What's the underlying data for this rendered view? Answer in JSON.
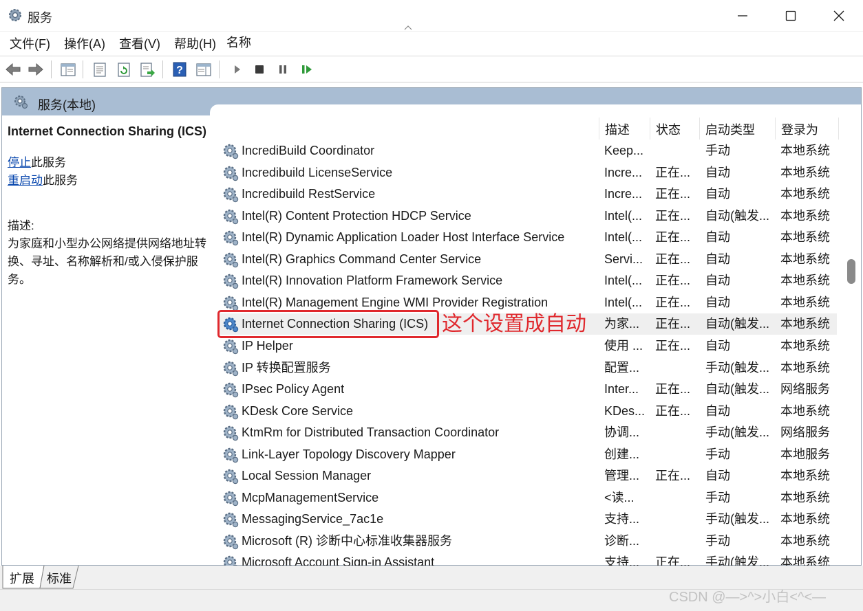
{
  "window": {
    "title": "服务",
    "icons": {
      "app": "gear-icon",
      "minimize": "minimize-icon",
      "maximize": "maximize-icon",
      "close": "close-icon"
    }
  },
  "menubar": {
    "items": [
      "文件(F)",
      "操作(A)",
      "查看(V)",
      "帮助(H)"
    ]
  },
  "toolbar": {
    "icons": [
      "back-arrow-icon",
      "forward-arrow-icon",
      "show-hide-console-tree-icon",
      "properties-icon",
      "refresh-icon",
      "export-list-icon",
      "help-icon",
      "show-action-pane-icon",
      "start-service-icon",
      "stop-service-icon",
      "pause-service-icon",
      "restart-service-icon"
    ]
  },
  "scope": {
    "title": "服务(本地)"
  },
  "detail": {
    "service_title": "Internet Connection Sharing (ICS)",
    "stop_link": "停止",
    "stop_suffix": "此服务",
    "restart_link": "重启动",
    "restart_suffix": "此服务",
    "desc_label": "描述:",
    "desc_text": "为家庭和小型办公网络提供网络地址转换、寻址、名称解析和/或入侵保护服务。"
  },
  "columns": {
    "name": "名称",
    "desc": "描述",
    "state": "状态",
    "startup": "启动类型",
    "logon": "登录为"
  },
  "services": [
    {
      "name": "IncrediBuild Coordinator",
      "desc": "Keep...",
      "state": "",
      "startup": "手动",
      "logon": "本地系统"
    },
    {
      "name": "Incredibuild LicenseService",
      "desc": "Incre...",
      "state": "正在...",
      "startup": "自动",
      "logon": "本地系统"
    },
    {
      "name": "Incredibuild RestService",
      "desc": "Incre...",
      "state": "正在...",
      "startup": "自动",
      "logon": "本地系统"
    },
    {
      "name": "Intel(R) Content Protection HDCP Service",
      "desc": "Intel(...",
      "state": "正在...",
      "startup": "自动(触发...",
      "logon": "本地系统"
    },
    {
      "name": "Intel(R) Dynamic Application Loader Host Interface Service",
      "desc": "Intel(...",
      "state": "正在...",
      "startup": "自动",
      "logon": "本地系统"
    },
    {
      "name": "Intel(R) Graphics Command Center Service",
      "desc": "Servi...",
      "state": "正在...",
      "startup": "自动",
      "logon": "本地系统"
    },
    {
      "name": "Intel(R) Innovation Platform Framework Service",
      "desc": "Intel(...",
      "state": "正在...",
      "startup": "自动",
      "logon": "本地系统"
    },
    {
      "name": "Intel(R) Management Engine WMI Provider Registration",
      "desc": "Intel(...",
      "state": "正在...",
      "startup": "自动",
      "logon": "本地系统"
    },
    {
      "name": "Internet Connection Sharing (ICS)",
      "desc": "为家...",
      "state": "正在...",
      "startup": "自动(触发...",
      "logon": "本地系统"
    },
    {
      "name": "IP Helper",
      "desc": "使用 ...",
      "state": "正在...",
      "startup": "自动",
      "logon": "本地系统"
    },
    {
      "name": "IP 转换配置服务",
      "desc": "配置...",
      "state": "",
      "startup": "手动(触发...",
      "logon": "本地系统"
    },
    {
      "name": "IPsec Policy Agent",
      "desc": "Inter...",
      "state": "正在...",
      "startup": "自动(触发...",
      "logon": "网络服务"
    },
    {
      "name": "KDesk Core Service",
      "desc": "KDes...",
      "state": "正在...",
      "startup": "自动",
      "logon": "本地系统"
    },
    {
      "name": "KtmRm for Distributed Transaction Coordinator",
      "desc": "协调...",
      "state": "",
      "startup": "手动(触发...",
      "logon": "网络服务"
    },
    {
      "name": "Link-Layer Topology Discovery Mapper",
      "desc": "创建...",
      "state": "",
      "startup": "手动",
      "logon": "本地服务"
    },
    {
      "name": "Local Session Manager",
      "desc": "管理...",
      "state": "正在...",
      "startup": "自动",
      "logon": "本地系统"
    },
    {
      "name": "McpManagementService",
      "desc": "<读...",
      "state": "",
      "startup": "手动",
      "logon": "本地系统"
    },
    {
      "name": "MessagingService_7ac1e",
      "desc": "支持...",
      "state": "",
      "startup": "手动(触发...",
      "logon": "本地系统"
    },
    {
      "name": "Microsoft (R) 诊断中心标准收集器服务",
      "desc": "诊断...",
      "state": "",
      "startup": "手动",
      "logon": "本地系统"
    },
    {
      "name": "Microsoft Account Sign-in Assistant",
      "desc": "支持...",
      "state": "正在...",
      "startup": "手动(触发...",
      "logon": "本地系统"
    }
  ],
  "annotation": {
    "text": "这个设置成自动",
    "color": "#e0282d"
  },
  "tabs": [
    "扩展",
    "标准"
  ],
  "watermark": "CSDN @—>^>小白<^<—"
}
